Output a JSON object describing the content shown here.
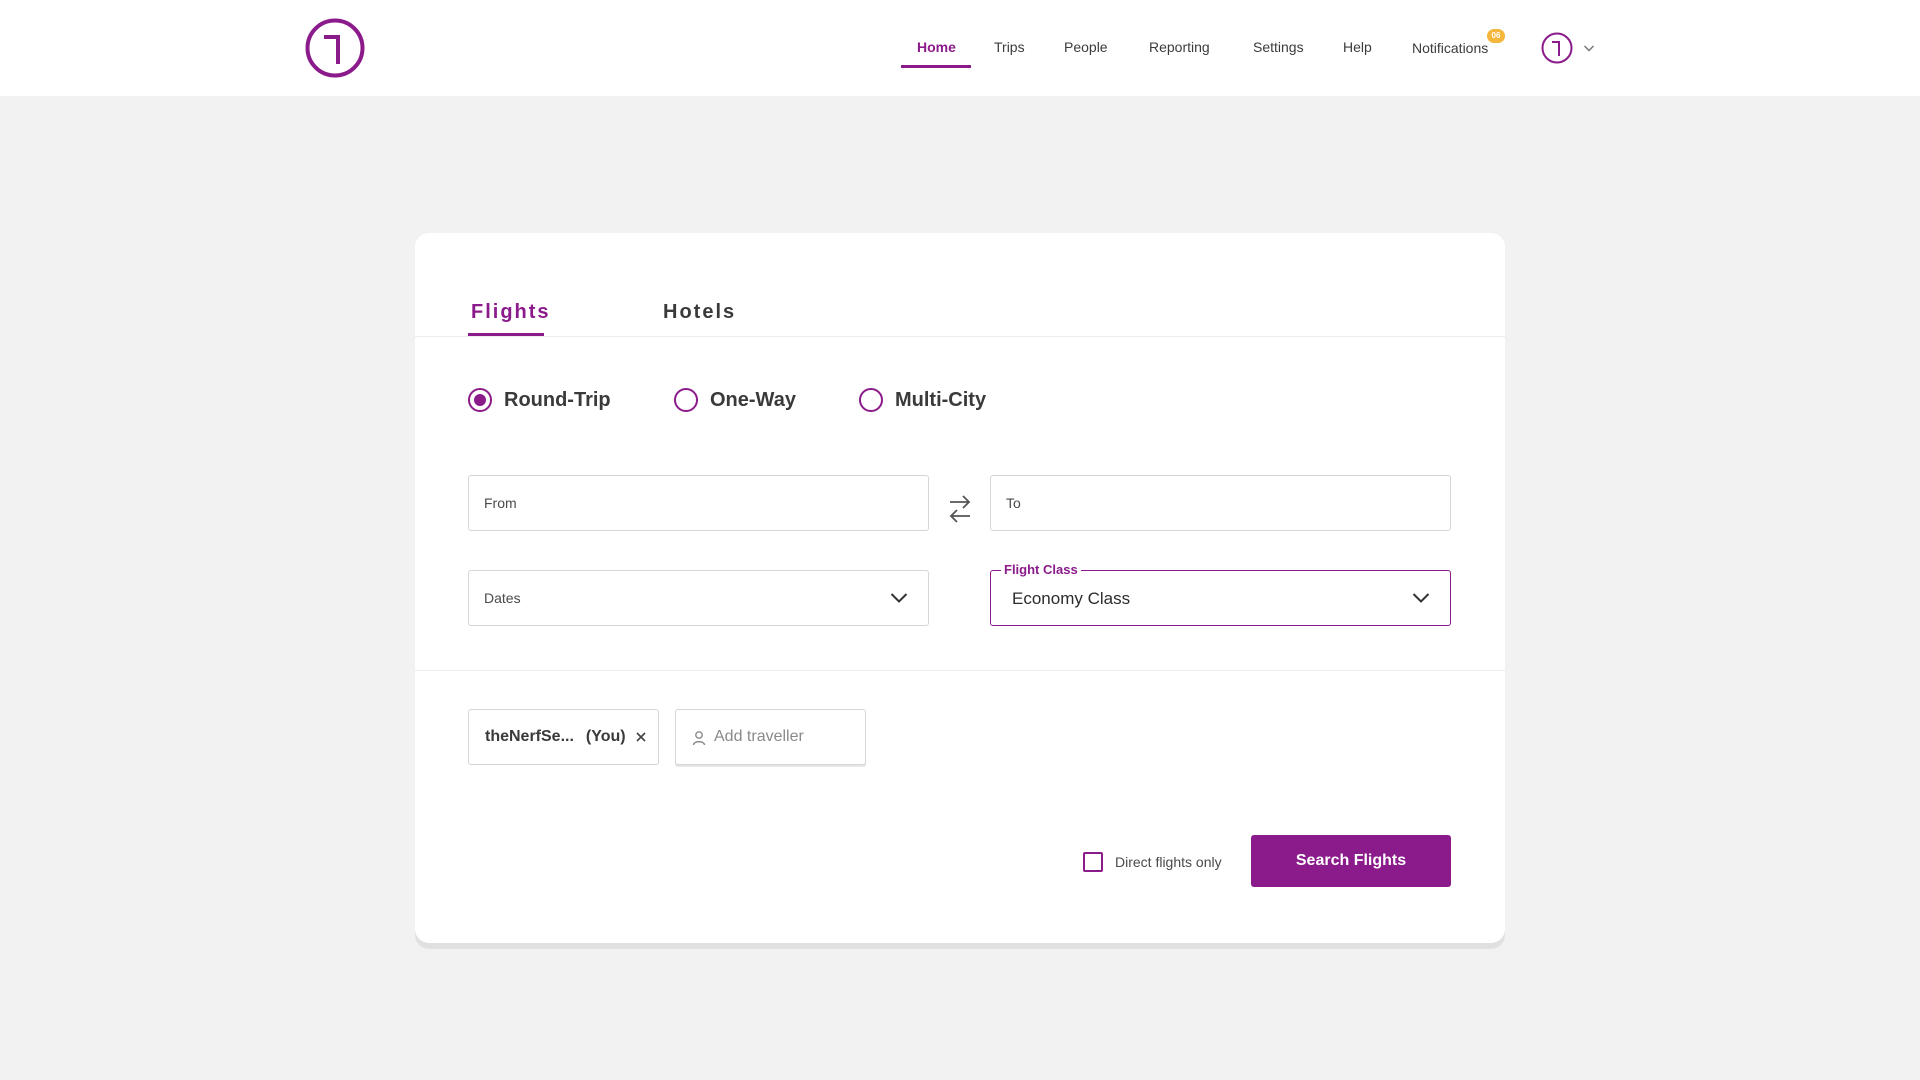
{
  "header": {
    "logo_icon": "brand-logo-icon",
    "nav": [
      {
        "label": "Home",
        "active": true
      },
      {
        "label": "Trips"
      },
      {
        "label": "People"
      },
      {
        "label": "Reporting"
      },
      {
        "label": "Settings"
      },
      {
        "label": "Help"
      },
      {
        "label": "Notifications"
      }
    ],
    "notification_count": "06",
    "accent_color": "#8b1a8b",
    "badge_color": "#f5b73b"
  },
  "tabs": [
    {
      "label": "Flights",
      "active": true
    },
    {
      "label": "Hotels"
    }
  ],
  "trip_types": [
    {
      "label": "Round-Trip",
      "checked": true
    },
    {
      "label": "One-Way"
    },
    {
      "label": "Multi-City"
    }
  ],
  "fields": {
    "from_placeholder": "From",
    "to_placeholder": "To",
    "dates_label": "Dates",
    "flight_class_label": "Flight Class",
    "flight_class_value": "Economy Class"
  },
  "travellers": {
    "chip_name": "theNerfSe...",
    "chip_you": "(You)",
    "add_placeholder": "Add traveller"
  },
  "options": {
    "direct_only_label": "Direct flights only",
    "direct_only_checked": false
  },
  "search_button_label": "Search Flights"
}
